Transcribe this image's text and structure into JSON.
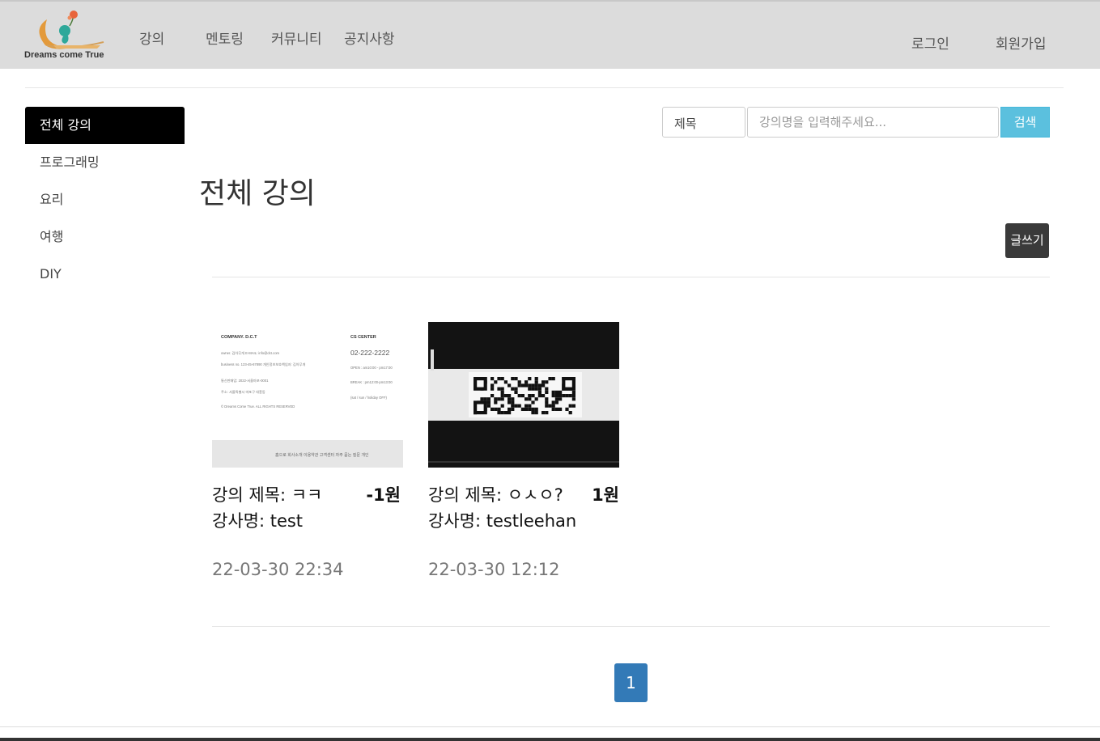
{
  "header": {
    "logo_text": "Dreams come True",
    "nav": [
      "강의",
      "멘토링",
      "커뮤니티",
      "공지사항"
    ],
    "login": "로그인",
    "signup": "회원가입"
  },
  "sidebar": {
    "items": [
      "전체 강의",
      "프로그래밍",
      "요리",
      "여행",
      "DIY"
    ],
    "active_index": 0
  },
  "search": {
    "select_value": "제목",
    "placeholder": "강의명을 입력해주세요...",
    "button_label": "검색"
  },
  "main": {
    "title": "전체 강의",
    "write_button": "글쓰기"
  },
  "lectures": [
    {
      "title": "강의 제목: ㅋㅋ",
      "price": "-1원",
      "author": "강사명: test",
      "date": "22-03-30 22:34"
    },
    {
      "title": "강의 제목: ㅇㅅㅇ?",
      "price": "1원",
      "author": "강사명: testleehan",
      "date": "22-03-30 12:12"
    }
  ],
  "thumb1": {
    "company": "COMPANY. D.C.T",
    "cs_center": "CS CENTER",
    "phone": "02-222-2222",
    "line1": "owner. 김아무개   E-MAIL: info@dct.com",
    "line2": "business no. 123-45-67890   개인정보보호책임자: 김아무개",
    "line3": "통신판매업: 2022-서울마포-0001",
    "line4": "주소: 서울특별시 마포구 대흥동",
    "copyright": "© Dreams Come True. ALL RIGHTS RESERVED",
    "open": "OPEN : am10:00 - pm17:00",
    "break": "BREAK : pm12:00-pm13:00",
    "off": "(sat / sun / holiday OFF)",
    "footer_links": "홈으로   회사소개   이용약관   고객센터   자주 묻는 질문   개인"
  },
  "pagination": {
    "current": "1"
  },
  "colors": {
    "header_bg": "#dcdcdc",
    "active_sidebar": "#000000",
    "search_button": "#5bc0de",
    "write_button": "#3a3a3a",
    "page_active": "#337ab7"
  }
}
